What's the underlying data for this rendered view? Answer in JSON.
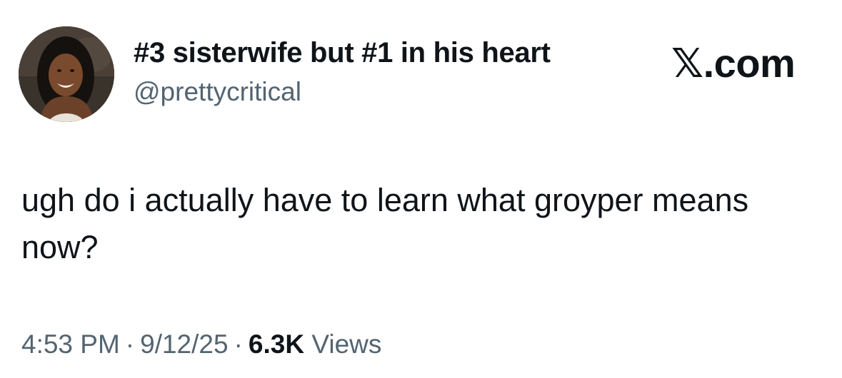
{
  "author": {
    "display_name": "#3 sisterwife but #1 in his heart",
    "handle": "@prettycritical",
    "avatar_icon": "profile-photo"
  },
  "site": {
    "label": "𝕏.com"
  },
  "tweet": {
    "text": "ugh do i actually have to learn what groyper means now?",
    "time": "4:53 PM",
    "date": "9/12/25",
    "separator": "·",
    "views_count": "6.3K",
    "views_label": "Views"
  },
  "colors": {
    "text_primary": "#0f1419",
    "text_secondary": "#536471",
    "background": "#ffffff"
  }
}
